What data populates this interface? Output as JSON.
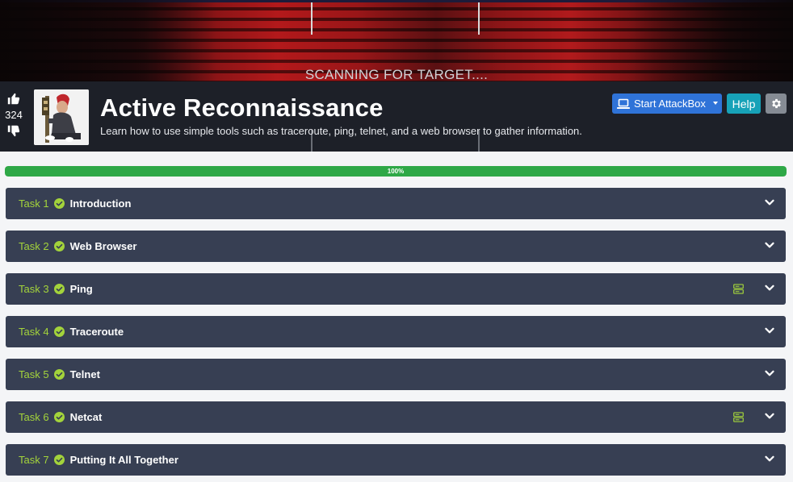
{
  "banner": {
    "scan_text": "SCANNING FOR TARGET....",
    "colors": {
      "red": "#b3191b",
      "bar": "#1d2028"
    }
  },
  "room": {
    "title": "Active Reconnaissance",
    "description": "Learn how to use simple tools such as traceroute, ping, telnet, and a web browser to gather information.",
    "votes": "324",
    "avatar_icon": "hacker-avatar-icon"
  },
  "actions": {
    "attackbox_label": "Start AttackBox",
    "help_label": "Help",
    "attackbox_color": "#2f73d8",
    "help_color": "#17a2b8",
    "gear_color": "#858b94"
  },
  "progress": {
    "value": 100,
    "label": "100%",
    "color": "#2ea847"
  },
  "tasks": [
    {
      "number": "Task 1",
      "name": "Introduction",
      "completed": true,
      "has_machine": false
    },
    {
      "number": "Task 2",
      "name": "Web Browser",
      "completed": true,
      "has_machine": false
    },
    {
      "number": "Task 3",
      "name": "Ping",
      "completed": true,
      "has_machine": true
    },
    {
      "number": "Task 4",
      "name": "Traceroute",
      "completed": true,
      "has_machine": false
    },
    {
      "number": "Task 5",
      "name": "Telnet",
      "completed": true,
      "has_machine": false
    },
    {
      "number": "Task 6",
      "name": "Netcat",
      "completed": true,
      "has_machine": true
    },
    {
      "number": "Task 7",
      "name": "Putting It All Together",
      "completed": true,
      "has_machine": false
    }
  ],
  "task_colors": {
    "background": "#373f53",
    "number": "#a3d33b",
    "check": "#a3d33b"
  }
}
